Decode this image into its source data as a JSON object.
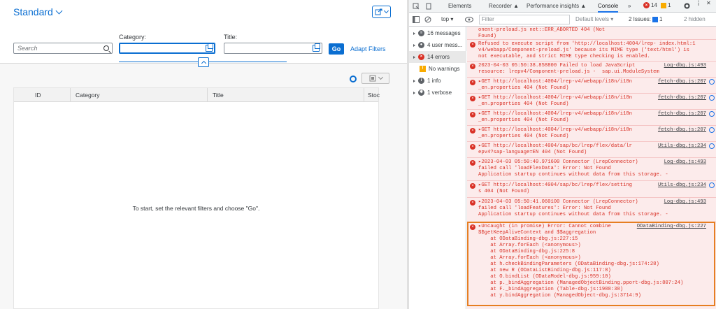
{
  "app": {
    "variant_title": "Standard",
    "filters": {
      "search_placeholder": "Search",
      "category_label": "Category:",
      "title_label": "Title:",
      "go_label": "Go",
      "adapt_label": "Adapt Filters"
    },
    "table": {
      "columns": [
        "ID",
        "Category",
        "Title",
        "Stoc"
      ],
      "empty_text": "To start, set the relevant filters and choose \"Go\"."
    }
  },
  "devtools": {
    "tabs": [
      "Elements",
      "Recorder ▲",
      "Performance insights ▲",
      "Console",
      "»"
    ],
    "errors_badge": "14",
    "warnings_badge": "1",
    "toolbar": {
      "context": "top",
      "filter_placeholder": "Filter",
      "levels": "Default levels ▾",
      "issues": "2 Issues: ",
      "issues_count": "1",
      "hidden": "2 hidden"
    },
    "sidebar": [
      {
        "label": "16 messages",
        "kind": "msg"
      },
      {
        "label": "4 user mess...",
        "kind": "user"
      },
      {
        "label": "14 errors",
        "kind": "error"
      },
      {
        "label": "No warnings",
        "kind": "warning"
      },
      {
        "label": "1 info",
        "kind": "info"
      },
      {
        "label": "1 verbose",
        "kind": "verbose"
      }
    ],
    "entries": [
      {
        "text": "onent-preload.js net::ERR_ABORTED 404 (Not\nFound)",
        "src": ""
      },
      {
        "text": "Refused to execute script from 'http://localhost:4004/lrep- index.html:1\nv4/webapp/Component-preload.js' because its MIME type ('text/html') is\nnot executable, and strict MIME type checking is enabled.",
        "src": ""
      },
      {
        "text": "2023-04-03 05:50:38.858800 Failed to load JavaScript\nresource: lrepv4/Component-preload.js -  sap.ui.ModuleSystem",
        "src": "Log-dbg.js:493"
      },
      {
        "text": "▸GET http://localhost:4004/lrep-v4/webapp/i18n/i18n\n_en.properties 404 (Not Found)",
        "src": "fetch-dbg.js:207"
      },
      {
        "text": "▸GET http://localhost:4004/lrep-v4/webapp/i18n/i18n\n_en.properties 404 (Not Found)",
        "src": "fetch-dbg.js:207"
      },
      {
        "text": "▸GET http://localhost:4004/lrep-v4/webapp/i18n/i18n\n_en.properties 404 (Not Found)",
        "src": "fetch-dbg.js:207"
      },
      {
        "text": "▸GET http://localhost:4004/lrep-v4/webapp/i18n/i18n\n_en.properties 404 (Not Found)",
        "src": "fetch-dbg.js:207"
      },
      {
        "text": "▸GET http://localhost:4004/sap/bc/lrep/flex/data/lr\nepv4?sap-language=EN 404 (Not Found)",
        "src": "Utils-dbg.js:234"
      },
      {
        "text": "▸2023-04-03 05:50:40.971600 Connector (LrepConnector)\nfailed call 'loadFlexData': Error: Not Found\nApplication startup continues without data from this storage. -",
        "src": "Log-dbg.js:493"
      },
      {
        "text": "▸GET http://localhost:4004/sap/bc/lrep/flex/setting\ns 404 (Not Found)",
        "src": "Utils-dbg.js:234"
      },
      {
        "text": "▸2023-04-03 05:50:41.060100 Connector (LrepConnector)\nfailed call 'loadFeatures': Error: Not Found\nApplication startup continues without data from this storage. -",
        "src": "Log-dbg.js:493"
      },
      {
        "text": "▸Uncaught (in promise) Error: Cannot combine\n$$getKeepAliveContext and $$aggregation\n    at ODataBinding-dbg.js:227:15\n    at Array.forEach (<anonymous>)\n    at ODataBinding-dbg.js:225:8\n    at Array.forEach (<anonymous>)\n    at h.checkBindingParameters (ODataBinding-dbg.js:174:28)\n    at new R (ODataListBinding-dbg.js:117:8)\n    at O.bindList (ODataModel-dbg.js:959:10)\n    at p._bindAggregation (ManagedObjectBinding.pport-dbg.js:807:24)\n    at F._bindAggregation (Table-dbg.js:1988:38)\n    at y.bindAggregation (ManagedObject-dbg.js:3714:9)",
        "src": "ODataBinding-dbg.js:227"
      }
    ]
  }
}
